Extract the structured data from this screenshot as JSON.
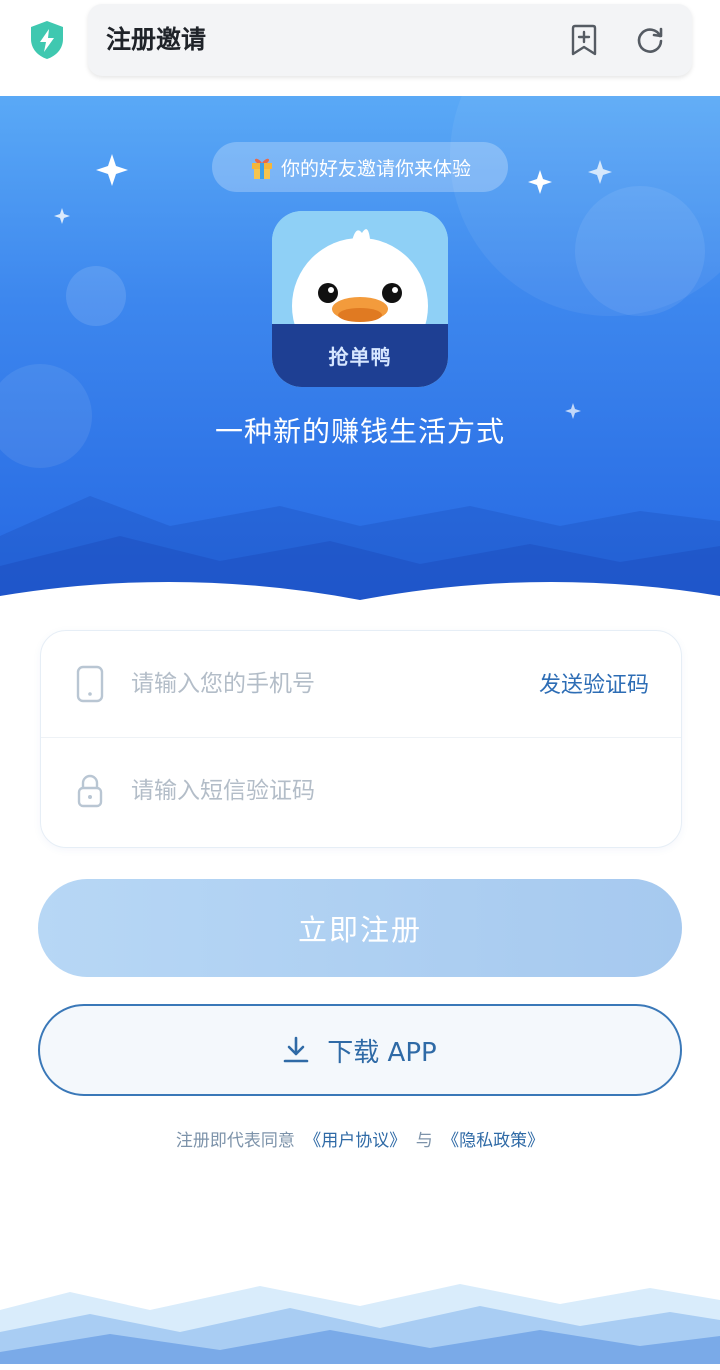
{
  "browser": {
    "title": "注册邀请",
    "icons": {
      "security": "shield-bolt-icon",
      "bookmark": "bookmark-add-icon",
      "refresh": "refresh-icon"
    }
  },
  "hero": {
    "invite_text": "你的好友邀请你来体验",
    "invite_icon": "gift-icon",
    "app_name": "抢单鸭",
    "slogan": "一种新的赚钱生活方式"
  },
  "form": {
    "phone_placeholder": "请输入您的手机号",
    "phone_icon": "phone-icon",
    "send_code_label": "发送验证码",
    "code_placeholder": "请输入短信验证码",
    "code_icon": "lock-icon"
  },
  "actions": {
    "register_label": "立即注册",
    "download_label": "下载 APP",
    "download_icon": "download-icon"
  },
  "agreement": {
    "prefix": "注册即代表同意",
    "user_agreement": "《用户协议》",
    "conjunction": "与",
    "privacy_policy": "《隐私政策》"
  },
  "colors": {
    "hero_top": "#5aa9f6",
    "hero_bottom": "#2567e2",
    "accent_link": "#2d6db5",
    "register_button": "#b7d7f5",
    "shield": "#3fc8b0"
  }
}
